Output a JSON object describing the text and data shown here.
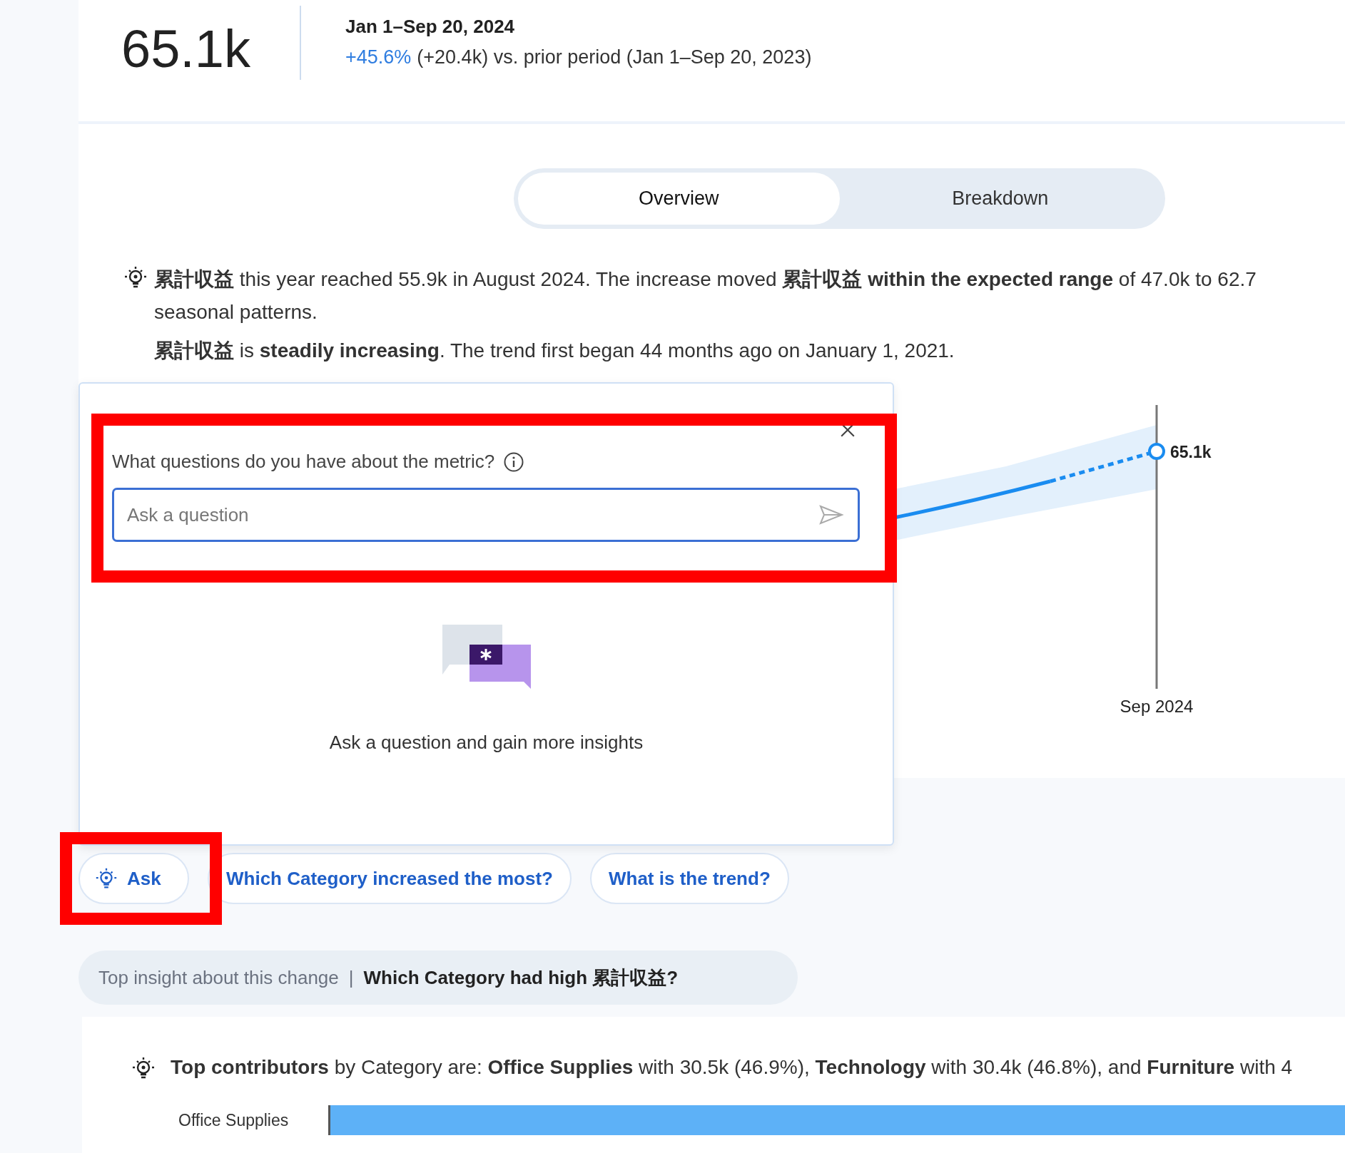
{
  "metric": {
    "value": "65.1k",
    "period": "Jan 1–Sep 20, 2024",
    "change": "+45.6%",
    "change_detail": "(+20.4k) vs. prior period (Jan 1–Sep 20, 2023)"
  },
  "tabs": [
    {
      "label": "Overview",
      "selected": true
    },
    {
      "label": "Breakdown",
      "selected": false
    }
  ],
  "insight": {
    "lines": [
      "**累計収益** this year reached 55.9k in August 2024. The increase moved **累計収益** **within the expected range** of 47.0k to 62.7",
      "seasonal patterns."
    ],
    "trend": "**累計収益** is **steadily increasing**. The trend first began 44 months ago on January 1, 2021."
  },
  "chart": {
    "point_label": "65.1k",
    "x_label": "Sep 2024"
  },
  "ask_panel": {
    "label": "What questions do you have about the metric?",
    "placeholder": "Ask a question",
    "empty_text": "Ask a question and gain more insights"
  },
  "suggestions": [
    {
      "label": "Ask",
      "kind": "ask"
    },
    {
      "label": "Which Category increased the most?",
      "kind": "question"
    },
    {
      "label": "What is the trend?",
      "kind": "question"
    }
  ],
  "top_insight": {
    "label": "Top insight about this change",
    "separator": "|",
    "question": "Which Category had high 累計収益?"
  },
  "contributors": {
    "text": "**Top contributors** by Category are: **Office Supplies** with 30.5k (46.9%), **Technology** with 30.4k (46.8%), and **Furniture** with 4",
    "bars": [
      {
        "label": "Office Supplies"
      }
    ]
  }
}
